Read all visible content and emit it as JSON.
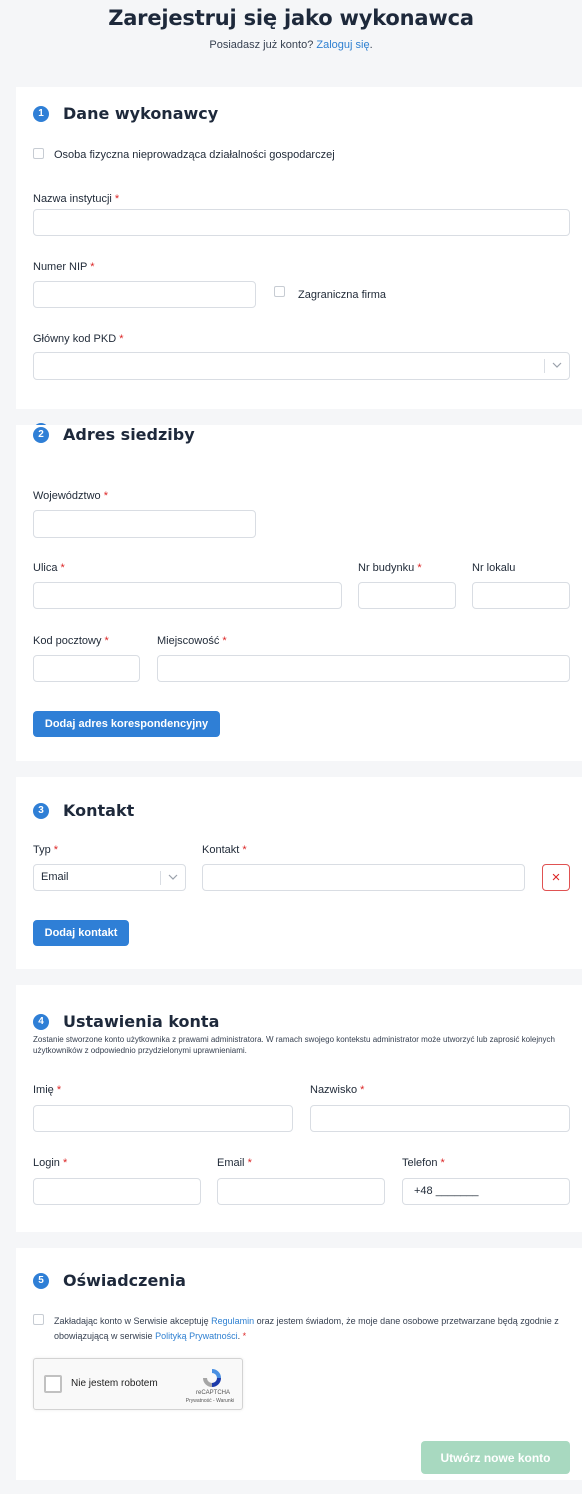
{
  "header": {
    "title": "Zarejestruj się jako wykonawca",
    "have_account": "Posiadasz już konto?",
    "login_link": "Zaloguj się"
  },
  "section1": {
    "number": "1",
    "title": "Dane wykonawcy",
    "private_person_label": "Osoba fizyczna nieprowadząca działalności gospodarczej",
    "institution_label": "Nazwa instytucji",
    "nip_label": "Numer NIP",
    "foreign_label": "Zagraniczna firma",
    "pkd_label": "Główny kod PKD"
  },
  "section2": {
    "number": "2",
    "title": "Adres siedziby",
    "voivodeship_label": "Województwo",
    "street_label": "Ulica",
    "building_label": "Nr budynku",
    "apartment_label": "Nr lokalu",
    "postal_label": "Kod pocztowy",
    "city_label": "Miejscowość",
    "add_address_button": "Dodaj adres korespondencyjny"
  },
  "section3": {
    "number": "3",
    "title": "Kontakt",
    "type_label": "Typ",
    "type_value": "Email",
    "contact_label": "Kontakt",
    "remove_icon": "×",
    "add_contact_button": "Dodaj kontakt"
  },
  "section4": {
    "number": "4",
    "title": "Ustawienia konta",
    "description": "Zostanie stworzone konto użytkownika z prawami administratora. W ramach swojego kontekstu administrator może utworzyć lub zaprosić kolejnych użytkowników z odpowiednio przydzielonymi uprawnieniami.",
    "first_name_label": "Imię",
    "last_name_label": "Nazwisko",
    "login_label": "Login",
    "email_label": "Email",
    "phone_label": "Telefon",
    "phone_value": "+48 _______"
  },
  "section5": {
    "number": "5",
    "title": "Oświadczenia",
    "consent_part1": "Zakładając konto w Serwisie akceptuję",
    "consent_regulamin": "Regulamin",
    "consent_part2": "oraz jestem świadom, że moje dane osobowe przetwarzane będą zgodnie z obowiązującą w serwisie",
    "consent_privacy": "Polityką Prywatności",
    "consent_end": ".",
    "captcha_label": "Nie jestem robotem",
    "captcha_brand": "reCAPTCHA",
    "captcha_links": "Prywatność - Warunki",
    "create_button": "Utwórz nowe konto"
  },
  "required_mark": "*",
  "colors": {
    "primary": "#2f7fd6",
    "required": "#dc2626",
    "disabled_button": "#a8d9c0",
    "link": "#2f80d1"
  }
}
